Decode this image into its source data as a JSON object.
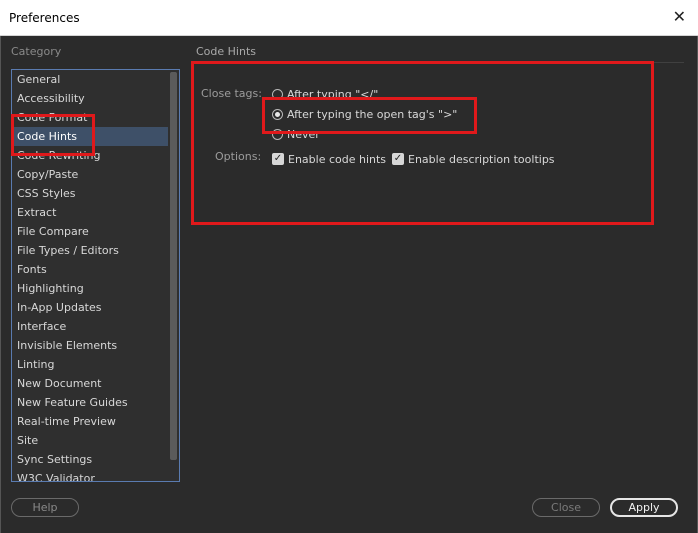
{
  "window": {
    "title": "Preferences",
    "close_glyph": "✕"
  },
  "sidebar": {
    "heading": "Category",
    "items": [
      {
        "label": "General"
      },
      {
        "label": "Accessibility"
      },
      {
        "label": "Code Format"
      },
      {
        "label": "Code Hints",
        "selected": true
      },
      {
        "label": "Code Rewriting"
      },
      {
        "label": "Copy/Paste"
      },
      {
        "label": "CSS Styles"
      },
      {
        "label": "Extract"
      },
      {
        "label": "File Compare"
      },
      {
        "label": "File Types / Editors"
      },
      {
        "label": "Fonts"
      },
      {
        "label": "Highlighting"
      },
      {
        "label": "In-App Updates"
      },
      {
        "label": "Interface"
      },
      {
        "label": "Invisible Elements"
      },
      {
        "label": "Linting"
      },
      {
        "label": "New Document"
      },
      {
        "label": "New Feature Guides"
      },
      {
        "label": "Real-time Preview"
      },
      {
        "label": "Site"
      },
      {
        "label": "Sync Settings"
      },
      {
        "label": "W3C Validator"
      }
    ]
  },
  "pane": {
    "title": "Code Hints",
    "close_tags": {
      "label": "Close tags:",
      "options": [
        {
          "label": "After typing \"</\"",
          "checked": false
        },
        {
          "label": "After typing the open tag's \">\"",
          "checked": true
        },
        {
          "label": "Never",
          "checked": false
        }
      ]
    },
    "options": {
      "label": "Options:",
      "checks": [
        {
          "label": "Enable code hints",
          "checked": true
        },
        {
          "label": "Enable description tooltips",
          "checked": true
        }
      ]
    }
  },
  "footer": {
    "help_label": "Help",
    "close_label": "Close",
    "apply_label": "Apply"
  },
  "colors": {
    "background": "#2b2b2b",
    "selection": "#3e5068",
    "highlight": "#e0191b"
  }
}
